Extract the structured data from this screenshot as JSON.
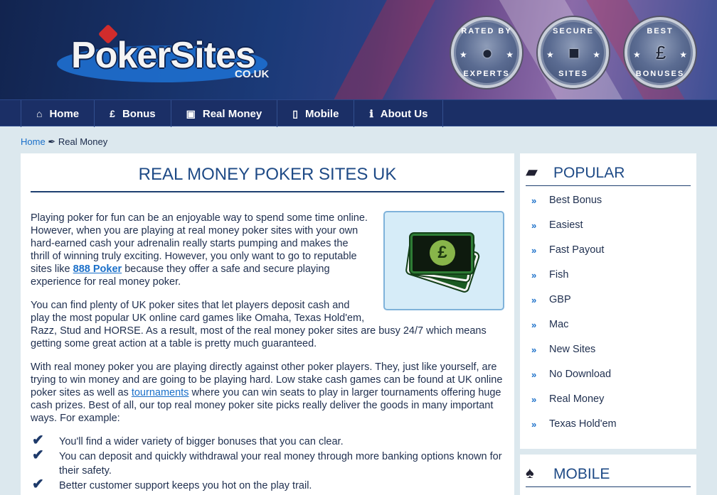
{
  "header": {
    "logo_text": "PokerSites",
    "logo_tld": "CO.UK",
    "badges": [
      {
        "top": "RATED BY",
        "bottom": "EXPERTS",
        "icon": "person-silhouette-icon"
      },
      {
        "top": "SECURE",
        "bottom": "SITES",
        "icon": "padlock-icon"
      },
      {
        "top": "BEST",
        "bottom": "BONUSES",
        "icon": "pound-coin-icon"
      }
    ]
  },
  "nav": [
    {
      "label": "Home",
      "icon": "home-icon",
      "glyph": "⌂"
    },
    {
      "label": "Bonus",
      "icon": "pound-icon",
      "glyph": "£"
    },
    {
      "label": "Real Money",
      "icon": "money-icon",
      "glyph": "▣"
    },
    {
      "label": "Mobile",
      "icon": "mobile-icon",
      "glyph": "▯"
    },
    {
      "label": "About Us",
      "icon": "info-icon",
      "glyph": "ℹ"
    }
  ],
  "breadcrumb": {
    "home": "Home",
    "sep": "✒",
    "current": "Real Money"
  },
  "main": {
    "title": "REAL MONEY POKER SITES UK",
    "p1_a": "Playing poker for fun can be an enjoyable way to spend some time online. However, when you are playing at real money poker sites with your own hard-earned cash your adrenalin really starts pumping and makes the thrill of winning truly exciting. However, you only want to go to reputable sites like ",
    "p1_link": "888 Poker",
    "p1_b": " because they offer a safe and secure playing experience for real money poker.",
    "p2": "You can find plenty of UK poker sites that let players deposit cash and play the most popular UK online card games like Omaha, Texas Hold'em, Razz, Stud and HORSE. As a result, most of the real money poker sites are busy 24/7 which means getting some great action at a table is pretty much guaranteed.",
    "p3_a": "With real money poker you are playing directly against other poker players. They, just like yourself, are trying to win money and are going to be playing hard. Low stake cash games can be found at UK online poker sites as well as ",
    "p3_link": "tournaments",
    "p3_b": " where you can win seats to play in larger tournaments offering huge cash prizes. Best of all, our top real money poker site picks really deliver the goods in many important ways. For example:",
    "checklist": [
      "You'll find a wider variety of bigger bonuses that you can clear.",
      "You can deposit and quickly withdrawal your real money through more banking options known for their safety.",
      "Better customer support keeps you hot on the play trail."
    ],
    "image_symbol": "£"
  },
  "sidebar": {
    "popular_title": "POPULAR",
    "popular_items": [
      "Best Bonus",
      "Easiest",
      "Fast Payout",
      "Fish",
      "GBP",
      "Mac",
      "New Sites",
      "No Download",
      "Real Money",
      "Texas Hold'em"
    ],
    "mobile_title": "MOBILE"
  },
  "colors": {
    "accent": "#1e4a86",
    "link": "#1a6fc9",
    "nav": "#1b2f66"
  }
}
